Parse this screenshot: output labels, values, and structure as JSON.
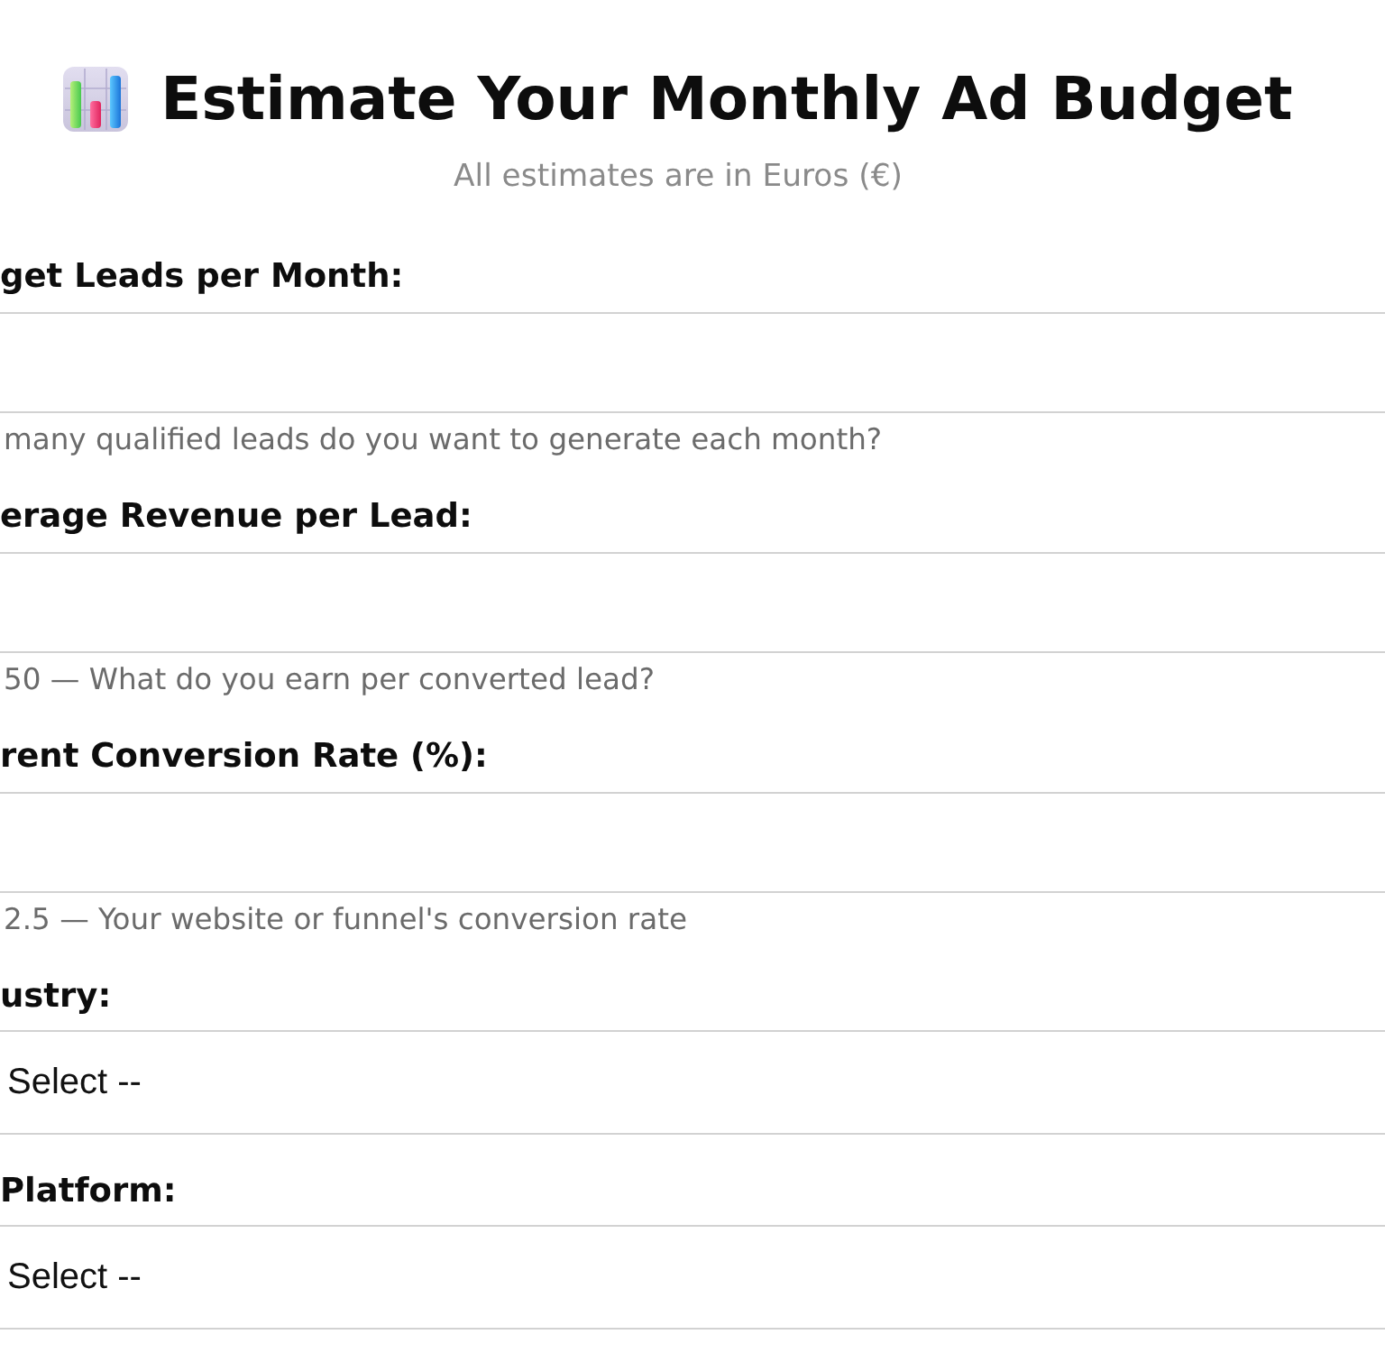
{
  "header": {
    "title": "Estimate Your Monthly Ad Budget",
    "subtitle": "All estimates are in Euros (€)"
  },
  "fields": [
    {
      "kind": "number",
      "label": "get Leads per Month:",
      "help": "many qualified leads do you want to generate each month?"
    },
    {
      "kind": "number",
      "label": "erage Revenue per Lead:",
      "help": "50 — What do you earn per converted lead?"
    },
    {
      "kind": "number",
      "label": "rent Conversion Rate (%):",
      "help": "2.5 — Your website or funnel's conversion rate"
    },
    {
      "kind": "select",
      "label": "ustry:",
      "value": "Select --"
    },
    {
      "kind": "select",
      "label": "Platform:",
      "value": "Select --"
    }
  ]
}
